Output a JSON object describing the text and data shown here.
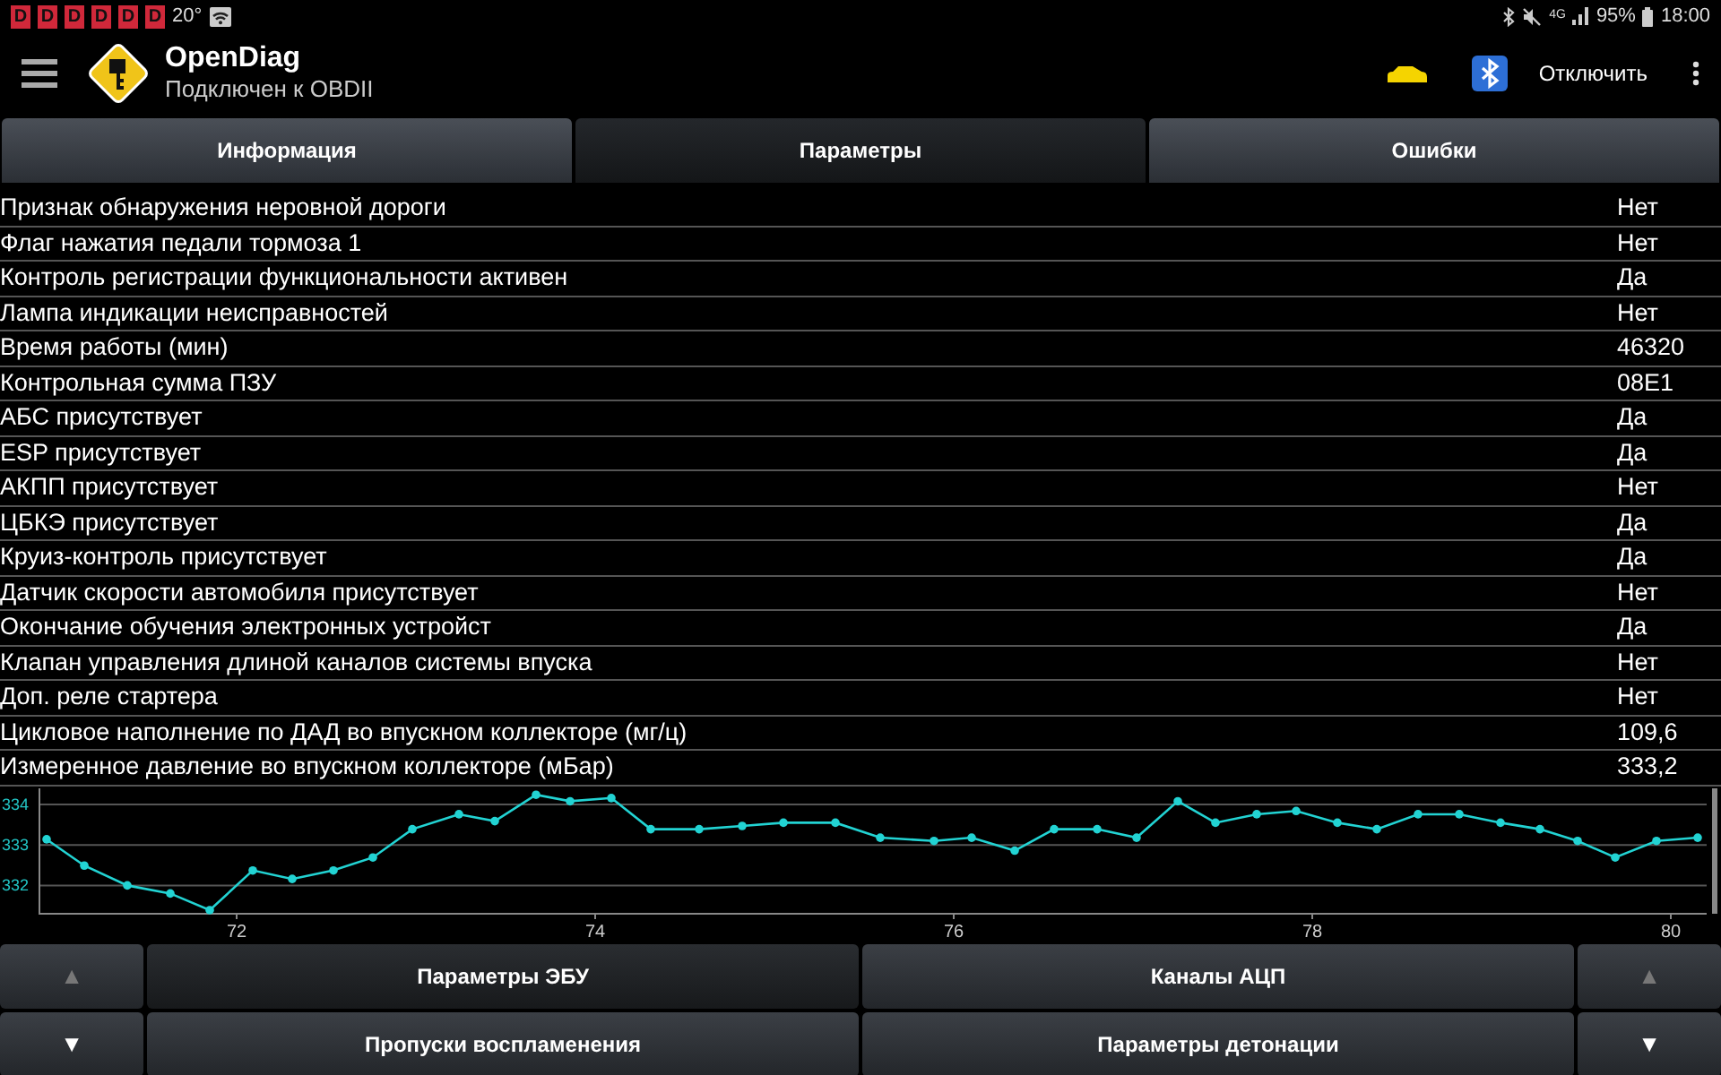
{
  "status_bar": {
    "notifications": [
      "D",
      "D",
      "D",
      "D",
      "D",
      "D"
    ],
    "temperature": "20°",
    "network": "4G",
    "battery": "95%",
    "time": "18:00"
  },
  "app_bar": {
    "title": "OpenDiag",
    "subtitle": "Подключен к OBDII",
    "action": "Отключить"
  },
  "tabs": [
    {
      "label": "Информация",
      "selected": false
    },
    {
      "label": "Параметры",
      "selected": true
    },
    {
      "label": "Ошибки",
      "selected": false
    }
  ],
  "parameters": [
    {
      "name": "Признак обнаружения неровной дороги",
      "value": "Нет"
    },
    {
      "name": "Флаг нажатия педали тормоза 1",
      "value": "Нет"
    },
    {
      "name": "Контроль регистрации функциональности активен",
      "value": "Да"
    },
    {
      "name": "Лампа индикации неисправностей",
      "value": "Нет"
    },
    {
      "name": "Время работы (мин)",
      "value": "46320"
    },
    {
      "name": "Контрольная сумма ПЗУ",
      "value": "08E1"
    },
    {
      "name": "АБС присутствует",
      "value": "Да"
    },
    {
      "name": "ESP присутствует",
      "value": "Да"
    },
    {
      "name": "АКПП присутствует",
      "value": "Нет"
    },
    {
      "name": "ЦБКЭ присутствует",
      "value": "Да"
    },
    {
      "name": "Круиз-контроль присутствует",
      "value": "Да"
    },
    {
      "name": "Датчик скорости автомобиля присутствует",
      "value": "Нет"
    },
    {
      "name": "Окончание обучения электронных устройст",
      "value": "Да"
    },
    {
      "name": "Клапан управления длиной каналов системы впуска",
      "value": "Нет"
    },
    {
      "name": "Доп. реле стартера",
      "value": "Нет"
    },
    {
      "name": "Цикловое наполнение по ДАД во впускном коллекторе (мг/ц)",
      "value": "109,6"
    },
    {
      "name": "Измеренное давление во впускном коллекторе (мБар)",
      "value": "333,2"
    }
  ],
  "chart": {
    "chart_data": {
      "type": "line",
      "grid": true,
      "xlim": [
        70.9,
        80.2
      ],
      "ylim": [
        331.3,
        334.4
      ],
      "xticks": [
        72,
        74,
        76,
        78,
        80
      ],
      "yticks": [
        332,
        333,
        334
      ],
      "x": [
        70.94,
        71.15,
        71.39,
        71.63,
        71.85,
        72.09,
        72.31,
        72.54,
        72.76,
        72.98,
        73.24,
        73.44,
        73.67,
        73.86,
        74.09,
        74.31,
        74.58,
        74.82,
        75.05,
        75.34,
        75.59,
        75.89,
        76.1,
        76.34,
        76.56,
        76.8,
        77.02,
        77.25,
        77.46,
        77.69,
        77.91,
        78.14,
        78.36,
        78.59,
        78.82,
        79.05,
        79.27,
        79.48,
        79.69,
        79.92,
        80.15
      ],
      "series": [
        {
          "color": "#22d3d3",
          "marker": "circle",
          "values": [
            333.14,
            332.49,
            332.0,
            331.8,
            331.39,
            332.37,
            332.16,
            332.37,
            332.69,
            333.39,
            333.76,
            333.59,
            334.24,
            334.08,
            334.16,
            333.39,
            333.39,
            333.47,
            333.55,
            333.55,
            333.18,
            333.1,
            333.18,
            332.86,
            333.39,
            333.39,
            333.18,
            334.08,
            333.55,
            333.76,
            333.84,
            333.55,
            333.39,
            333.76,
            333.76,
            333.55,
            333.39,
            333.1,
            332.69,
            333.1,
            333.18
          ]
        }
      ]
    }
  },
  "bottom_buttons": [
    {
      "kind": "arrow",
      "label": "▲",
      "disabled": true,
      "selected": false
    },
    {
      "kind": "text",
      "label": "Параметры ЭБУ",
      "disabled": false,
      "selected": true
    },
    {
      "kind": "text",
      "label": "Каналы АЦП",
      "disabled": false,
      "selected": false
    },
    {
      "kind": "arrow",
      "label": "▲",
      "disabled": true,
      "selected": false
    },
    {
      "kind": "arrow",
      "label": "▼",
      "disabled": false,
      "selected": false
    },
    {
      "kind": "text",
      "label": "Пропуски воспламенения",
      "disabled": false,
      "selected": false
    },
    {
      "kind": "text",
      "label": "Параметры детонации",
      "disabled": false,
      "selected": false
    },
    {
      "kind": "arrow",
      "label": "▼",
      "disabled": false,
      "selected": false
    }
  ]
}
